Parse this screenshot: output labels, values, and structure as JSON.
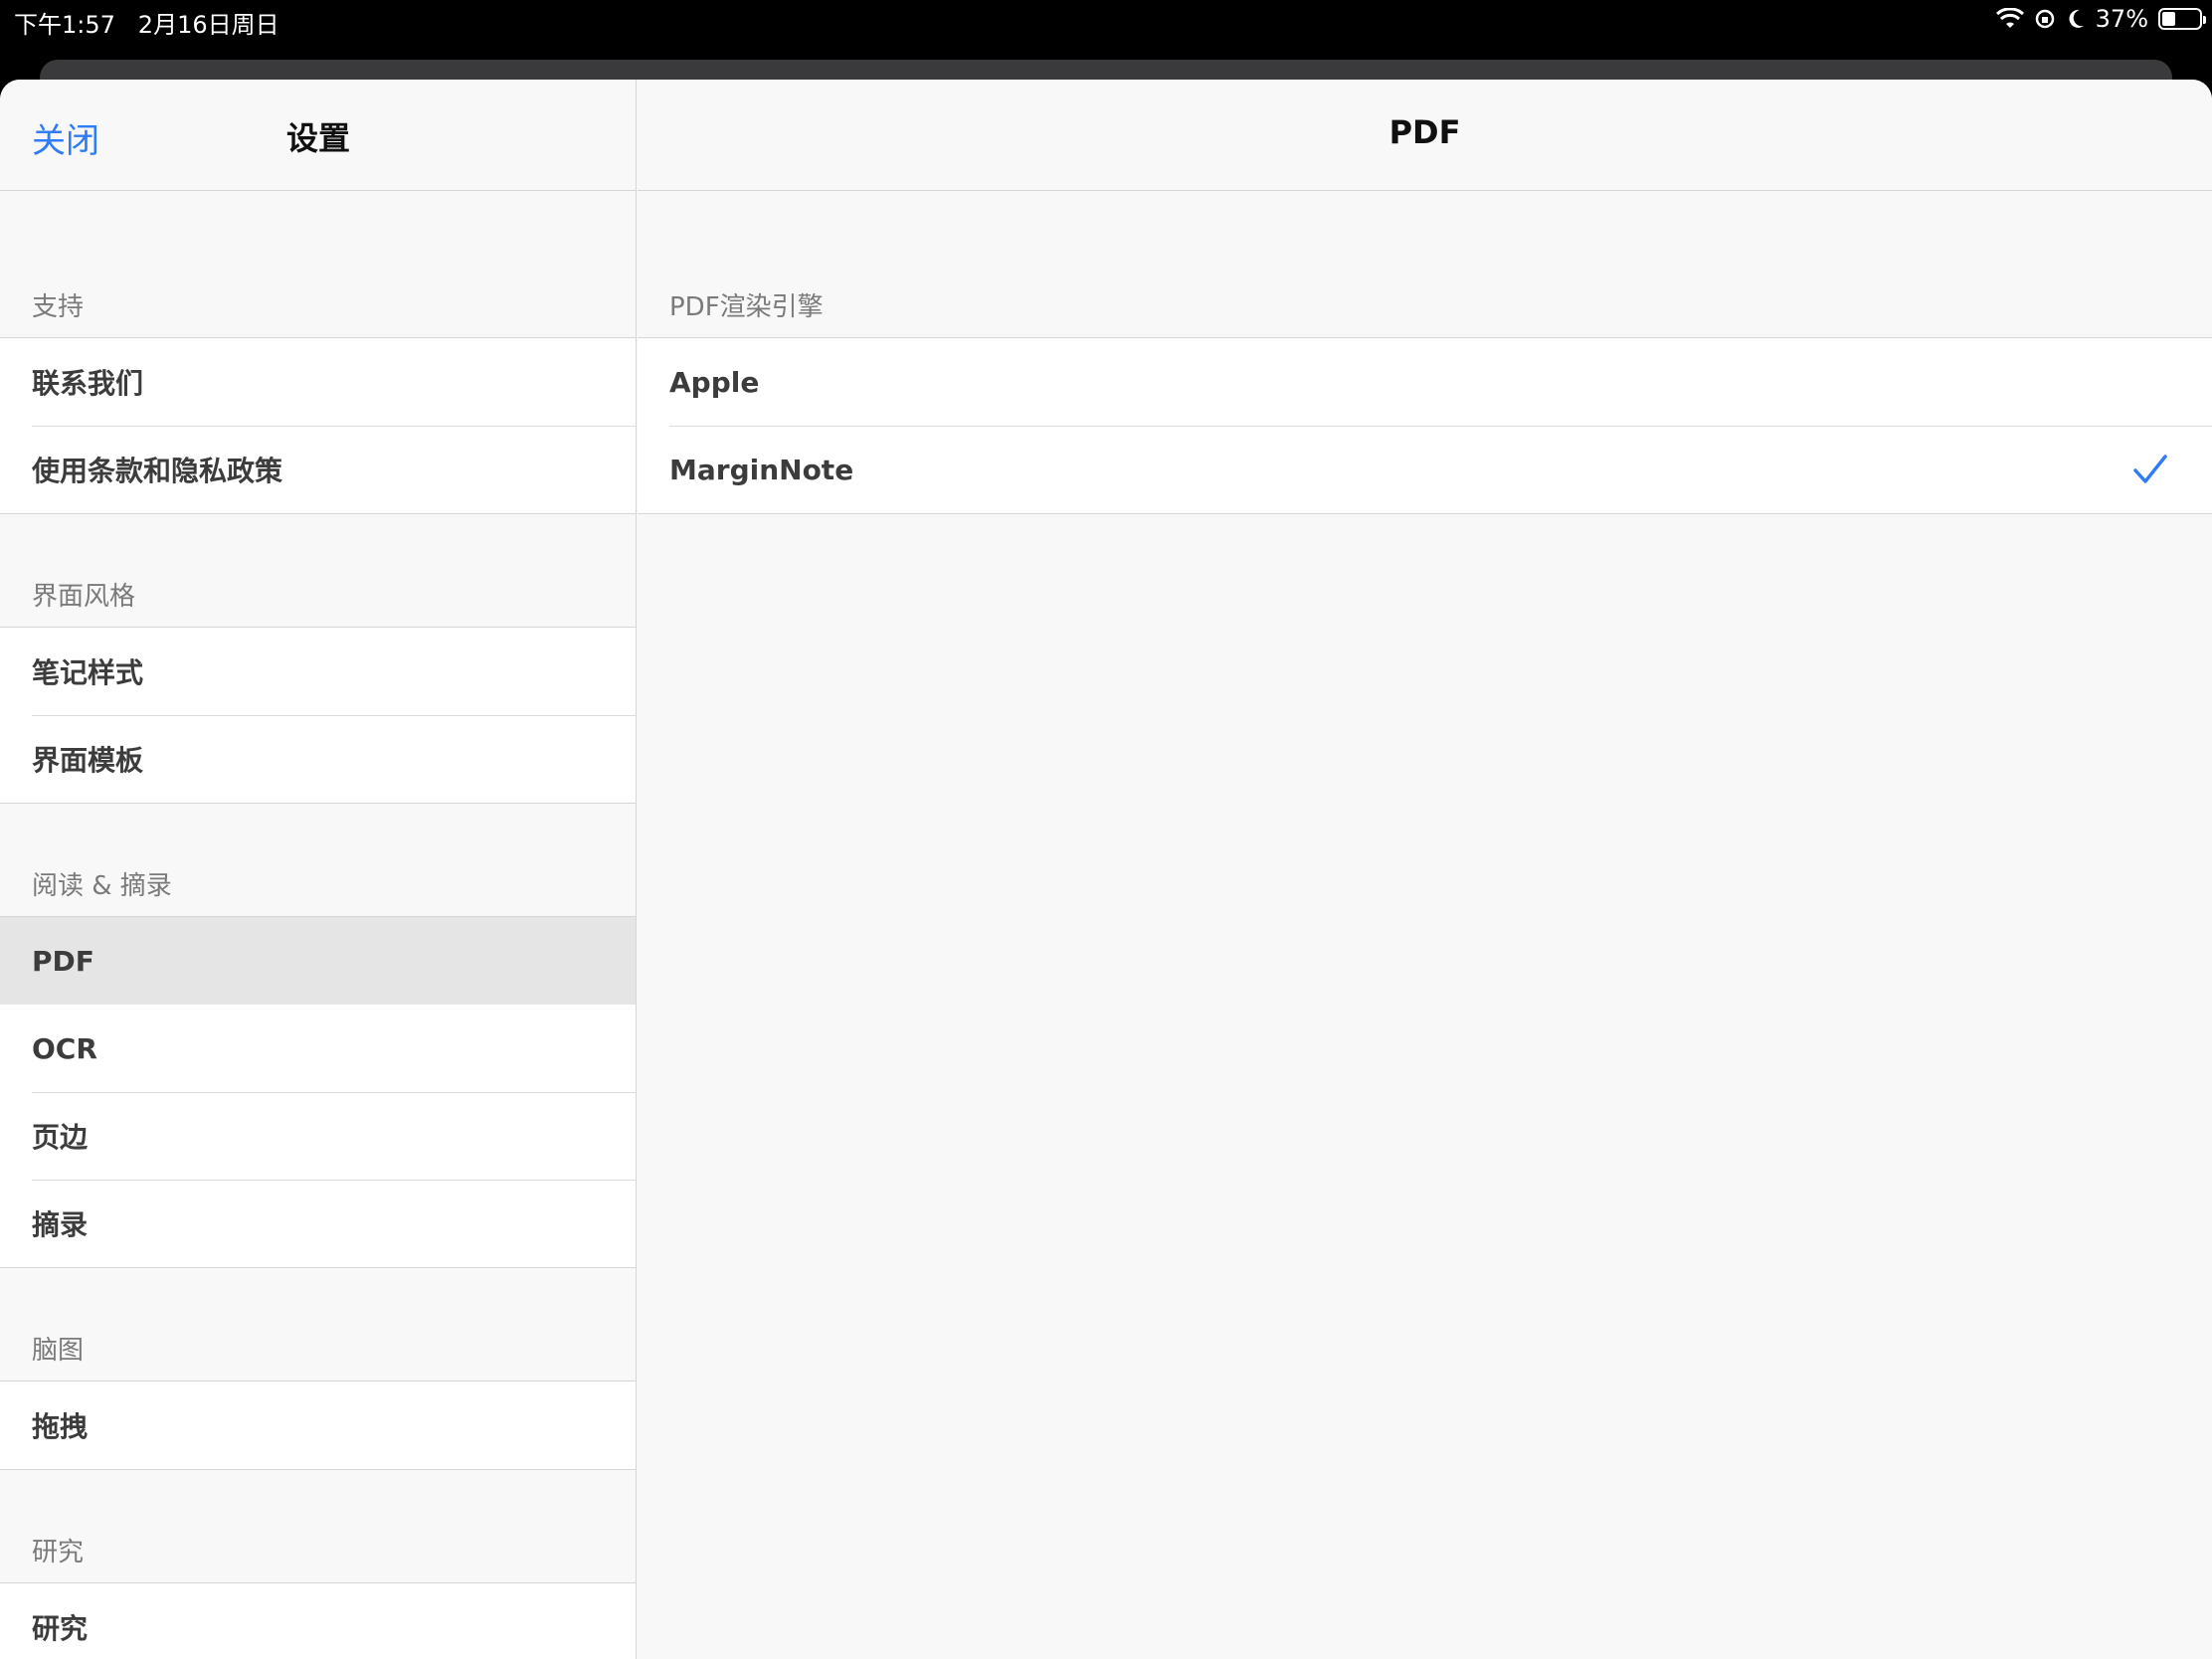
{
  "status_bar": {
    "time": "下午1:57",
    "date": "2月16日周日",
    "battery": "37%",
    "battery_level": 0.37
  },
  "master": {
    "close_label": "关闭",
    "title": "设置",
    "sections": [
      {
        "header": "支持",
        "items": [
          "联系我们",
          "使用条款和隐私政策"
        ]
      },
      {
        "header": "界面风格",
        "items": [
          "笔记样式",
          "界面模板"
        ]
      },
      {
        "header": "阅读 & 摘录",
        "items": [
          "PDF",
          "OCR",
          "页边",
          "摘录"
        ]
      },
      {
        "header": "脑图",
        "items": [
          "拖拽"
        ]
      },
      {
        "header": "研究",
        "items": [
          "研究"
        ]
      }
    ],
    "selected_item": "PDF"
  },
  "detail": {
    "title": "PDF",
    "section_header": "PDF渲染引擎",
    "options": [
      "Apple",
      "MarginNote"
    ],
    "selected_option": "MarginNote"
  },
  "colors": {
    "accent": "#2f7cf6",
    "background": "#f8f8f8",
    "selected_row": "#e5e5e5"
  }
}
